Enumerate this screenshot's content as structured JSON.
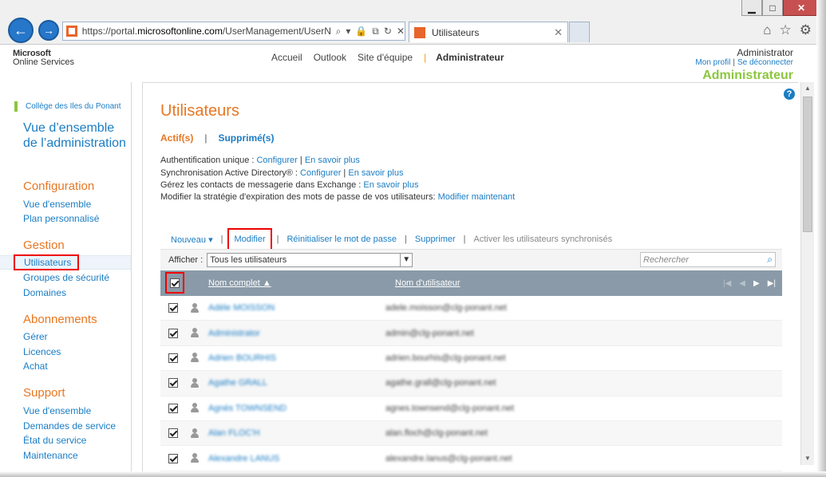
{
  "browser": {
    "url_prefix": "https://portal.",
    "url_domain": "microsoftonline.com",
    "url_rest": "/UserManagement/UserN",
    "tab_title": "Utilisateurs",
    "win_min": "▁",
    "win_max": "□",
    "win_close": "✕"
  },
  "header": {
    "logo_line1": "Microsoft",
    "logo_line2": "Online Services",
    "nav": [
      "Accueil",
      "Outlook",
      "Site d'équipe",
      "Administrateur"
    ],
    "user_name": "Administrator",
    "my_profile": "Mon profil",
    "sign_out": "Se déconnecter",
    "role": "Administrateur"
  },
  "sidebar": {
    "org": "Collège des Iles du Ponant",
    "overview": "Vue d’ensemble de l’administration",
    "configuration": {
      "title": "Configuration",
      "items": [
        "Vue d'ensemble",
        "Plan personnalisé"
      ]
    },
    "gestion": {
      "title": "Gestion",
      "items": [
        "Utilisateurs",
        "Groupes de sécurité",
        "Domaines"
      ]
    },
    "abonnements": {
      "title": "Abonnements",
      "items": [
        "Gérer",
        "Licences",
        "Achat"
      ]
    },
    "support": {
      "title": "Support",
      "items": [
        "Vue d'ensemble",
        "Demandes de service",
        "État du service",
        "Maintenance"
      ]
    }
  },
  "main": {
    "title": "Utilisateurs",
    "tab_active": "Actif(s)",
    "tab_deleted": "Supprimé(s)",
    "info": {
      "sso_label": "Authentification unique : ",
      "sso_configure": "Configurer",
      "sso_more": "En savoir plus",
      "ad_label": "Synchronisation Active Directory® : ",
      "ad_configure": "Configurer",
      "ad_more": "En savoir plus",
      "exch_label": "Gérez les contacts de messagerie dans Exchange : ",
      "exch_more": "En savoir plus",
      "pwd_label": "Modifier la stratégie d'expiration des mots de passe de vos utilisateurs: ",
      "pwd_link": "Modifier maintenant"
    },
    "toolbar": {
      "new": "Nouveau ▾",
      "modify": "Modifier",
      "reset": "Réinitialiser le mot de passe",
      "delete": "Supprimer",
      "activate": "Activer les utilisateurs synchronisés"
    },
    "filter": {
      "label": "Afficher :",
      "value": "Tous les utilisateurs",
      "search_placeholder": "Rechercher"
    },
    "table": {
      "col_name": "Nom complet ▲",
      "col_user": "Nom d'utilisateur",
      "rows": [
        {
          "name": "Adèle MOISSON",
          "user": "adele.moisson@clg-ponant.net"
        },
        {
          "name": "Administrator",
          "user": "admin@clg-ponant.net"
        },
        {
          "name": "Adrien BOURHIS",
          "user": "adrien.bourhis@clg-ponant.net"
        },
        {
          "name": "Agathe GRALL",
          "user": "agathe.grall@clg-ponant.net"
        },
        {
          "name": "Agnès TOWNSEND",
          "user": "agnes.townsend@clg-ponant.net"
        },
        {
          "name": "Alan FLOC'H",
          "user": "alan.floch@clg-ponant.net"
        },
        {
          "name": "Alexandre LANUS",
          "user": "alexandre.lanus@clg-ponant.net"
        }
      ]
    }
  },
  "colors": {
    "accent_orange": "#e87722",
    "link_blue": "#1a7dc4",
    "role_green": "#8cc63f",
    "highlight_red": "#e00000",
    "table_header": "#8a9aa8"
  }
}
